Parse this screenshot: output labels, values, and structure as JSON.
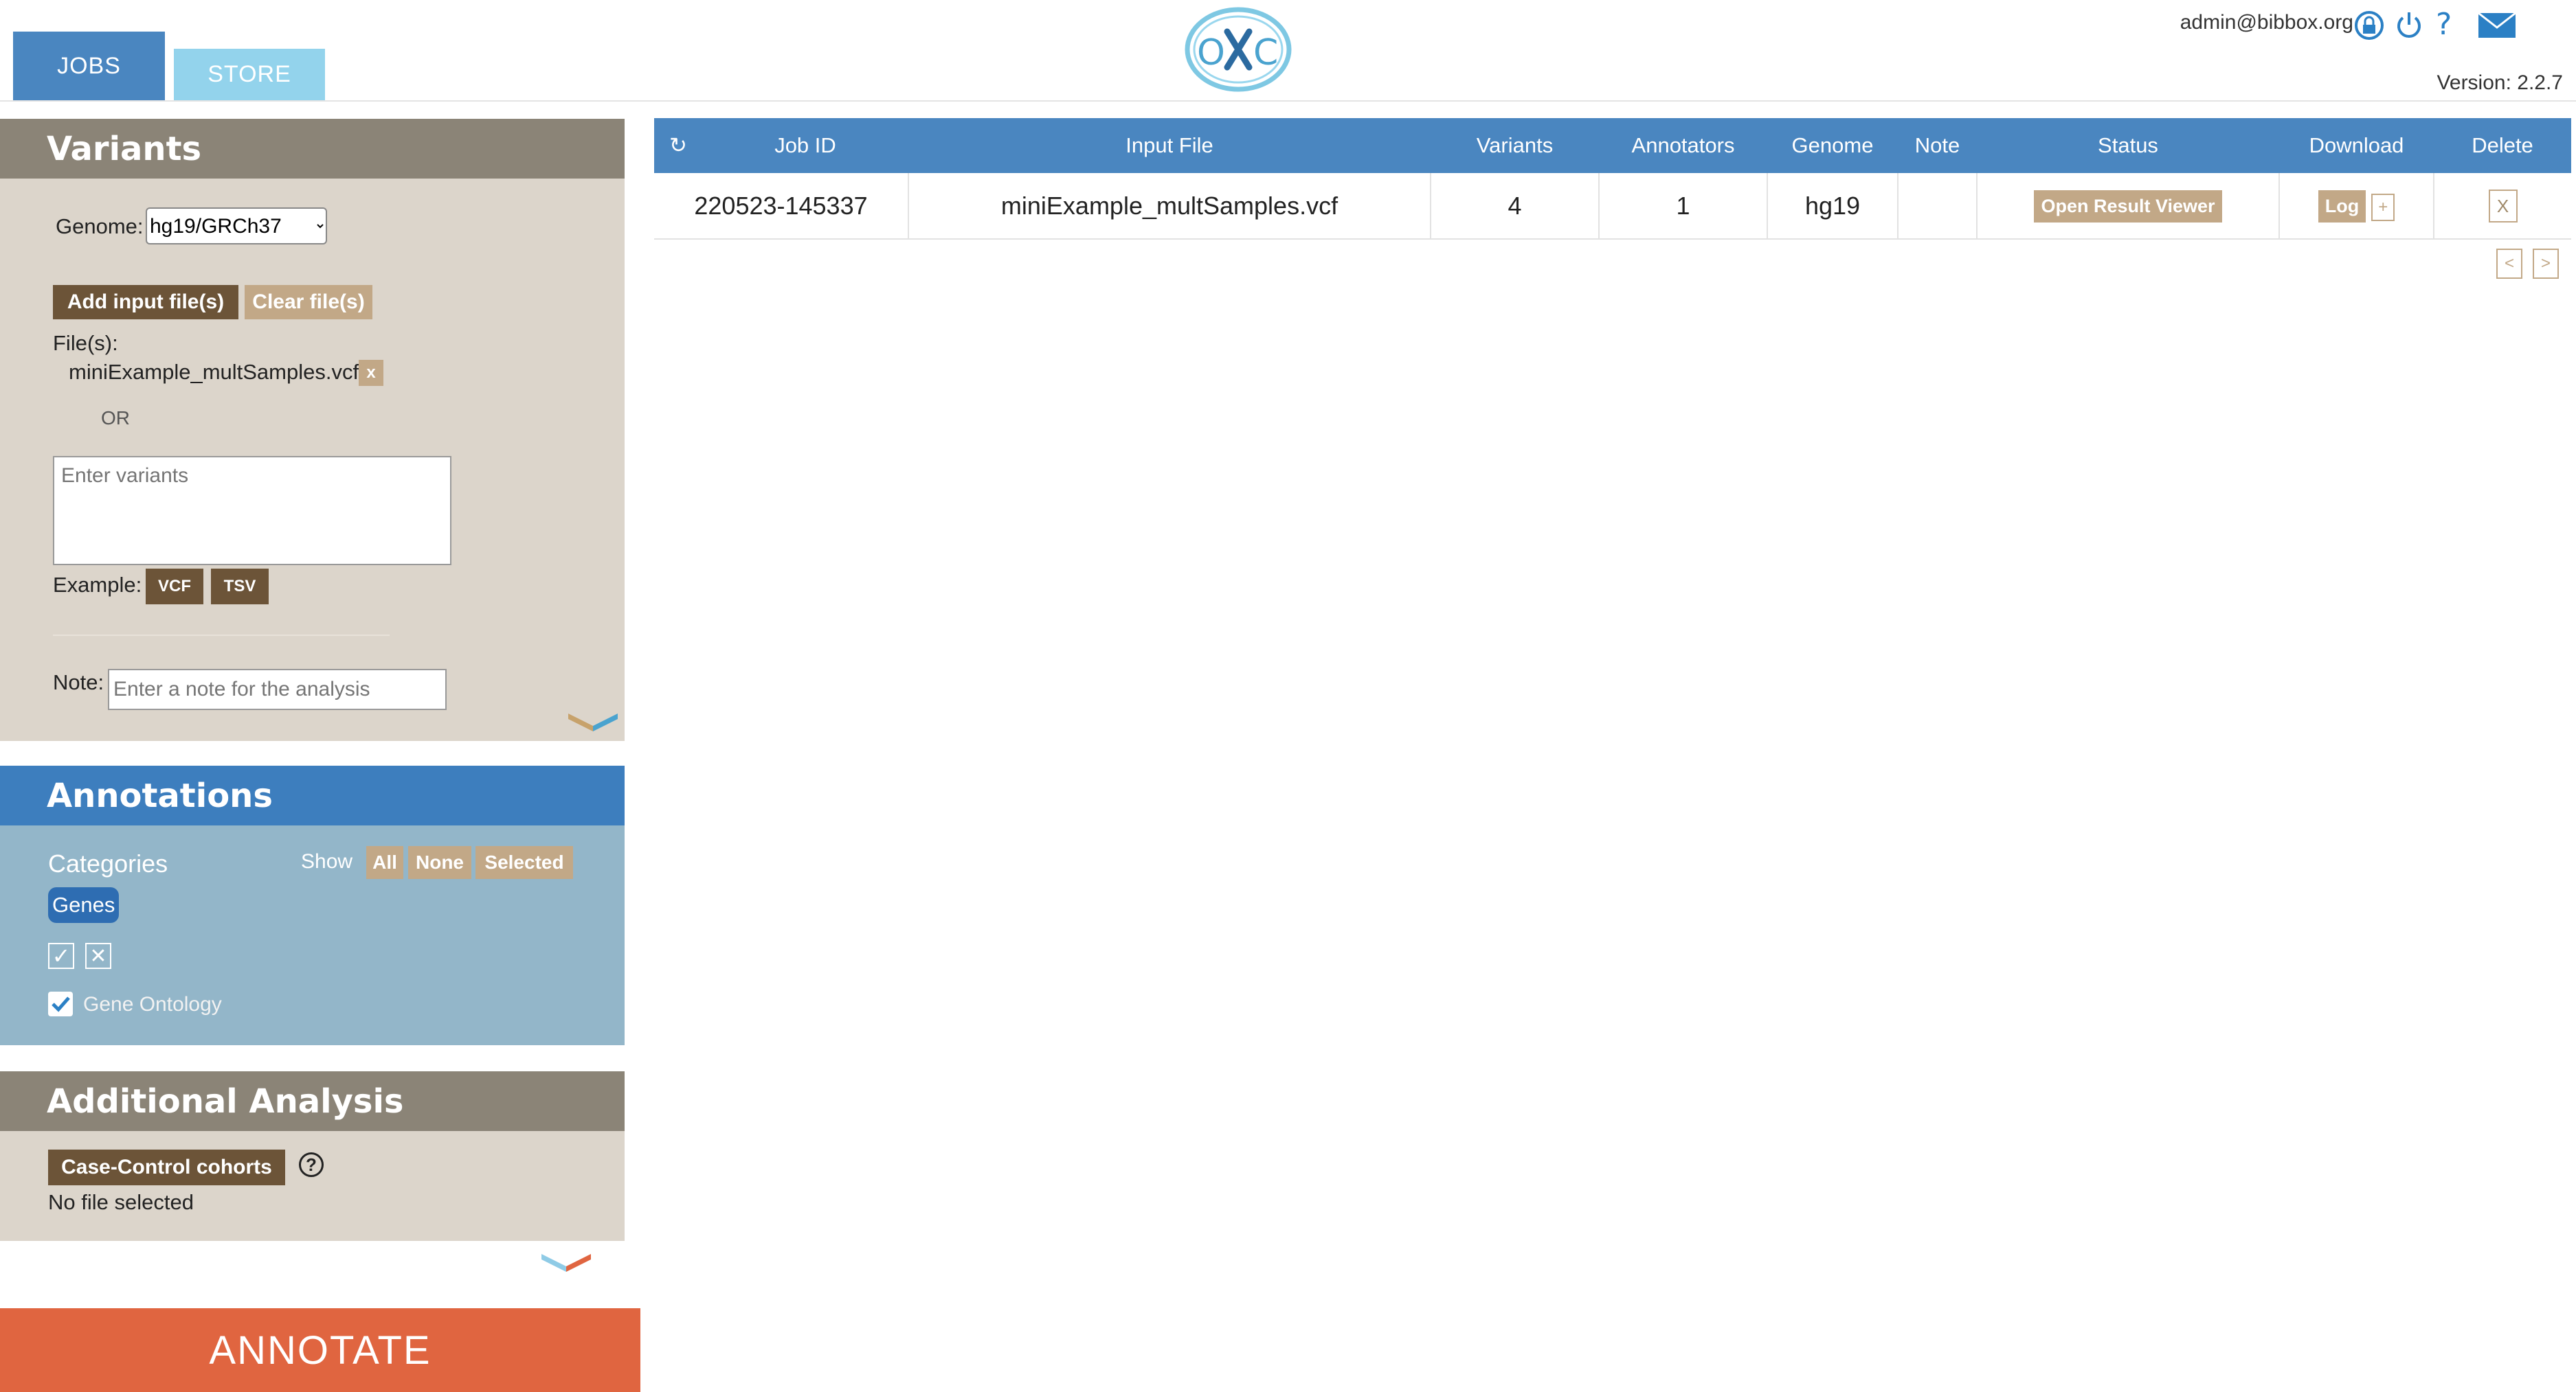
{
  "tabs": {
    "jobs": "JOBS",
    "store": "STORE"
  },
  "header": {
    "user": "admin@bibbox.org",
    "version": "Version: 2.2.7",
    "logo_text": "OXC"
  },
  "variants": {
    "title": "Variants",
    "genome_label": "Genome:",
    "genome_value": "hg19/GRCh37",
    "add_files": "Add input file(s)",
    "clear_files": "Clear file(s)",
    "files_label": "File(s):",
    "file_name": "miniExample_multSamples.vcf",
    "file_remove": "x",
    "or": "OR",
    "placeholder": "Enter variants",
    "example_label": "Example:",
    "example_vcf": "VCF",
    "example_tsv": "TSV",
    "note_label": "Note:",
    "note_placeholder": "Enter a note for the analysis"
  },
  "annotations": {
    "title": "Annotations",
    "categories": "Categories",
    "show": "Show",
    "all": "All",
    "none": "None",
    "selected": "Selected",
    "genes": "Genes",
    "check_all": "✓",
    "uncheck_all": "✕",
    "gene_ontology": "Gene Ontology"
  },
  "additional": {
    "title": "Additional Analysis",
    "case_control": "Case-Control cohorts",
    "help": "?",
    "no_file": "No file selected"
  },
  "annotate": "ANNOTATE",
  "table": {
    "refresh": "↻",
    "headers": [
      "Job ID",
      "Input File",
      "Variants",
      "Annotators",
      "Genome",
      "Note",
      "Status",
      "Download",
      "Delete"
    ],
    "row": {
      "job_id": "220523-145337",
      "input_file": "miniExample_multSamples.vcf",
      "variants": "4",
      "annotators": "1",
      "genome": "hg19",
      "note": "",
      "status": "Open Result Viewer",
      "log": "Log",
      "plus": "+",
      "delete": "X"
    },
    "prev": "<",
    "next": ">"
  },
  "colors": {
    "blue": "#4a86c0",
    "tan": "#c2a887",
    "brown": "#6c5438",
    "orange": "#e06540"
  }
}
